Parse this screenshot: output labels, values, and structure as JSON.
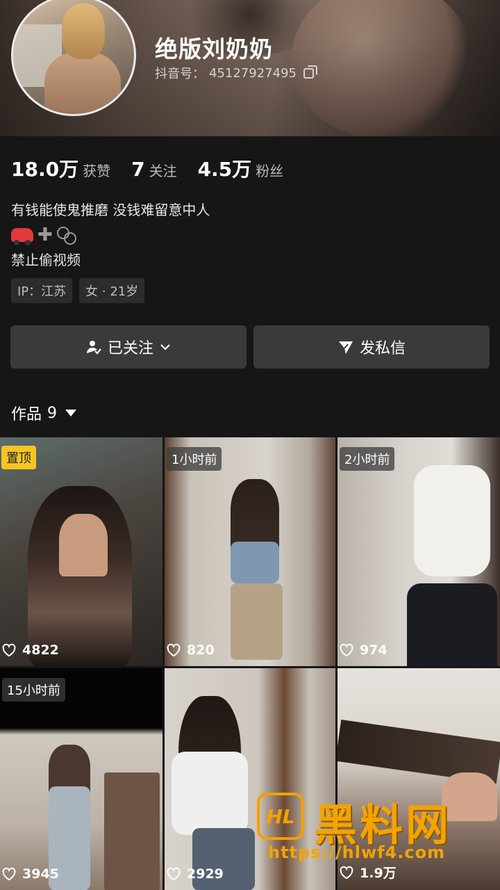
{
  "profile": {
    "username": "绝版刘奶奶",
    "douyin_id_label": "抖音号：",
    "douyin_id": "45127927495"
  },
  "stats": [
    {
      "value": "18.0万",
      "label": "获赞"
    },
    {
      "value": "7",
      "label": "关注"
    },
    {
      "value": "4.5万",
      "label": "粉丝"
    }
  ],
  "bio": {
    "line1": "有钱能使鬼推磨  没钱难留意中人",
    "emoji_icons": [
      "car-icon",
      "plus-icon",
      "link-icon"
    ],
    "line3": "禁止偷视频"
  },
  "tags": [
    "IP：江苏",
    "女 · 21岁"
  ],
  "buttons": {
    "follow": "已关注",
    "message": "发私信"
  },
  "works": {
    "label": "作品",
    "count": "9"
  },
  "videos": [
    {
      "badge": "置顶",
      "likes": "4822"
    },
    {
      "badge": "1小时前",
      "likes": "820"
    },
    {
      "badge": "2小时前",
      "likes": "974"
    },
    {
      "badge": "15小时前",
      "likes": "3945"
    },
    {
      "badge": "",
      "likes": "2929"
    },
    {
      "badge": "",
      "likes": "1.9万"
    }
  ],
  "watermark": {
    "logo": "HL",
    "text": "黑料网",
    "url": "https://hlwf4.com"
  },
  "colors": {
    "background": "#161616",
    "button": "#3a3a3a",
    "pinned_badge": "#f6c520",
    "watermark": "#f5a300"
  }
}
